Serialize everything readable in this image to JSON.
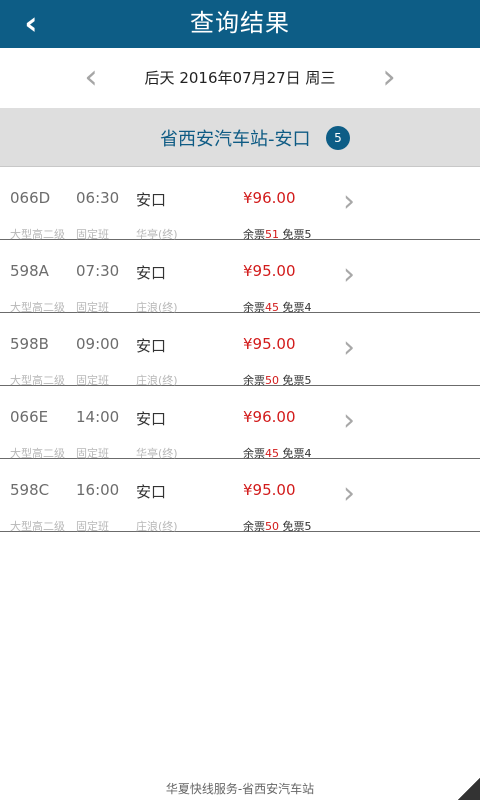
{
  "header": {
    "title": "查询结果",
    "back_icon": "chevron-left-icon"
  },
  "date_nav": {
    "prev_icon": "chevron-left-icon",
    "date_text": "后天  2016年07月27日 周三",
    "next_icon": "chevron-right-icon"
  },
  "route": {
    "title": "省西安汽车站-安口",
    "count": "5"
  },
  "schedules": [
    {
      "code": "066D",
      "time": "06:30",
      "destination": "安口",
      "price": "¥96.00",
      "bus_type": "大型高二级",
      "service_type": "固定班",
      "terminal": "华亭(终)",
      "remaining_label": "余票",
      "remaining": "51",
      "free_label": "免票",
      "free": "5"
    },
    {
      "code": "598A",
      "time": "07:30",
      "destination": "安口",
      "price": "¥95.00",
      "bus_type": "大型高二级",
      "service_type": "固定班",
      "terminal": "庄浪(终)",
      "remaining_label": "余票",
      "remaining": "45",
      "free_label": "免票",
      "free": "4"
    },
    {
      "code": "598B",
      "time": "09:00",
      "destination": "安口",
      "price": "¥95.00",
      "bus_type": "大型高二级",
      "service_type": "固定班",
      "terminal": "庄浪(终)",
      "remaining_label": "余票",
      "remaining": "50",
      "free_label": "免票",
      "free": "5"
    },
    {
      "code": "066E",
      "time": "14:00",
      "destination": "安口",
      "price": "¥96.00",
      "bus_type": "大型高二级",
      "service_type": "固定班",
      "terminal": "华亭(终)",
      "remaining_label": "余票",
      "remaining": "45",
      "free_label": "免票",
      "free": "4"
    },
    {
      "code": "598C",
      "time": "16:00",
      "destination": "安口",
      "price": "¥95.00",
      "bus_type": "大型高二级",
      "service_type": "固定班",
      "terminal": "庄浪(终)",
      "remaining_label": "余票",
      "remaining": "50",
      "free_label": "免票",
      "free": "5"
    }
  ],
  "footer": {
    "text": "华夏快线服务-省西安汽车站"
  },
  "colors": {
    "header_bg": "#0d5d86",
    "route_text": "#0e5b84",
    "price": "#d21b1b"
  }
}
